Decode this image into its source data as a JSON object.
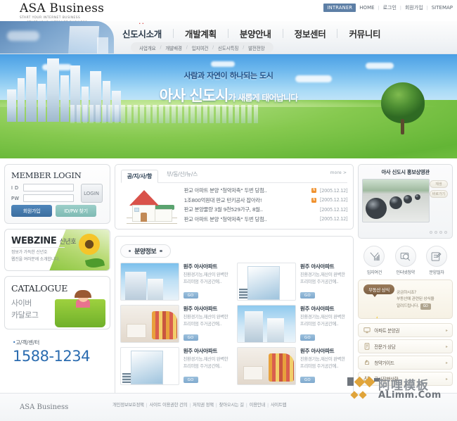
{
  "site": {
    "logo_main": "ASA Business",
    "logo_tagline_1": "START YOUR INTERNET BUSINESS",
    "logo_tagline_2": "START YOUR INTERNET BUSINESS"
  },
  "utilnav": {
    "intranet": "INTRANER",
    "links": [
      "HOME",
      "로그인",
      "회원가입",
      "SITEMAP"
    ]
  },
  "mainmenu": [
    {
      "label": "신도시소개"
    },
    {
      "label": "개발계획"
    },
    {
      "label": "분양안내"
    },
    {
      "label": "정보센터"
    },
    {
      "label": "커뮤니티"
    }
  ],
  "subnav": [
    "사업개요",
    "개발배경",
    "입지여건",
    "신도시특징",
    "발전전망"
  ],
  "hero": {
    "line1": "사람과 자연이 하나되는 도시",
    "big": "아사 신도시",
    "rest": "가 새롭게 태어납니다"
  },
  "login": {
    "title": "MEMBER LOGIN",
    "id_label": "I D",
    "pw_label": "PW",
    "id_value": "",
    "pw_value": "",
    "id_placeholder": "",
    "pw_placeholder": "",
    "login_button": "LOGIN",
    "join_button": "회원가입",
    "find_button": "ID/PW 찾기"
  },
  "webzine": {
    "title": "WEBZINE",
    "subtitle": "신년호",
    "desc_1": "정보가 가득한 신년호",
    "desc_2": "웹진을 여러분께 소개합니다."
  },
  "catalogue": {
    "title": "CATALOGUE",
    "sub_1": "사이버",
    "sub_2": "카달로그"
  },
  "customer": {
    "label": "고/객/센/터",
    "number": "1588-1234"
  },
  "board": {
    "tabs": [
      {
        "label": "공/지/사/항",
        "active": true
      },
      {
        "label": "부/동/산/뉴/스",
        "active": false
      }
    ],
    "more": "more >",
    "items": [
      {
        "title": "판교 아파트 분양 \"청약저축\" 두번 당첨..",
        "date": "[2005.12.12]",
        "is_new": true
      },
      {
        "title": "1조800억원대 판교 턴키공사 잡아라!",
        "date": "[2005.12.12]",
        "is_new": true
      },
      {
        "title": "판교 분양물량 3월 9천529가구, 8월..",
        "date": "[2005.12.12]",
        "is_new": false
      },
      {
        "title": "판교 아파트 분양 \"청약저축\" 두번 당첨..",
        "date": "[2005.12.12]",
        "is_new": false
      }
    ]
  },
  "sale": {
    "heading": "분양정보",
    "go_label": "GO",
    "cards": [
      {
        "title": "원주 아사아파트",
        "desc_1": "친환경기능,재산이 완벽한",
        "desc_2": "프리미엄 주거공간에..",
        "thumb": "apartment-photo"
      },
      {
        "title": "원주 아사아파트",
        "desc_1": "친환경기능,재산이 완벽한",
        "desc_2": "프리미엄 주거공간에..",
        "thumb": "building-photo"
      },
      {
        "title": "원주 아사아파트",
        "desc_1": "친환경기능,재산이 완벽한",
        "desc_2": "프리미엄 주거공간에..",
        "thumb": "interior-photo"
      },
      {
        "title": "원주 아사아파트",
        "desc_1": "친환경기능,재산이 완벽한",
        "desc_2": "프리미엄 주거공간에..",
        "thumb": "apartment-photo"
      },
      {
        "title": "원주 아사아파트",
        "desc_1": "친환경기능,재산이 완벽한",
        "desc_2": "프리미엄 주거공간에..",
        "thumb": "building-photo"
      },
      {
        "title": "원주 아사아파트",
        "desc_1": "친환경기능,재산이 완벽한",
        "desc_2": "프리미엄 주거공간에..",
        "thumb": "interior-photo"
      }
    ]
  },
  "video": {
    "title": "아사 신도시 홍보상영관",
    "buttons": [
      "재생",
      "바로가기"
    ]
  },
  "shortcuts": [
    {
      "label": "입지여건",
      "icon": "signal-tower-icon"
    },
    {
      "label": "인터넷청약",
      "icon": "magnifier-monitor-icon"
    },
    {
      "label": "분양절차",
      "icon": "book-pen-icon"
    }
  ],
  "tip": {
    "bubble": "부동산 상식",
    "line_1": "궁금하시죠?",
    "line_2": "부동산에 관련된 상식을",
    "line_3": "알려드립니다.",
    "go": "GO"
  },
  "quicklinks": [
    {
      "label": "아파트 분양권",
      "icon": "monitor-icon",
      "arrow": "▸"
    },
    {
      "label": "전문가 상담",
      "icon": "document-icon",
      "arrow": "▸"
    },
    {
      "label": "청약가이드",
      "icon": "hand-icon",
      "arrow": "▸"
    },
    {
      "label": "공사진행상황",
      "icon": "binoculars-icon",
      "arrow": "▸"
    }
  ],
  "footer": {
    "logo": "ASA Business",
    "links": [
      "개인정보보호정책",
      "사이트 이용권한 건의",
      "저작권 정책",
      "찾아오시는 길",
      "이용안내",
      "사이트맵"
    ],
    "watermark_cn": "阿哩模板",
    "watermark_en": "ALimm.Com"
  },
  "colors": {
    "accent_blue": "#2b6cb0",
    "nav_blue": "#5b86b5",
    "grass_green": "#7ec34a",
    "badge_orange": "#f0922f"
  }
}
